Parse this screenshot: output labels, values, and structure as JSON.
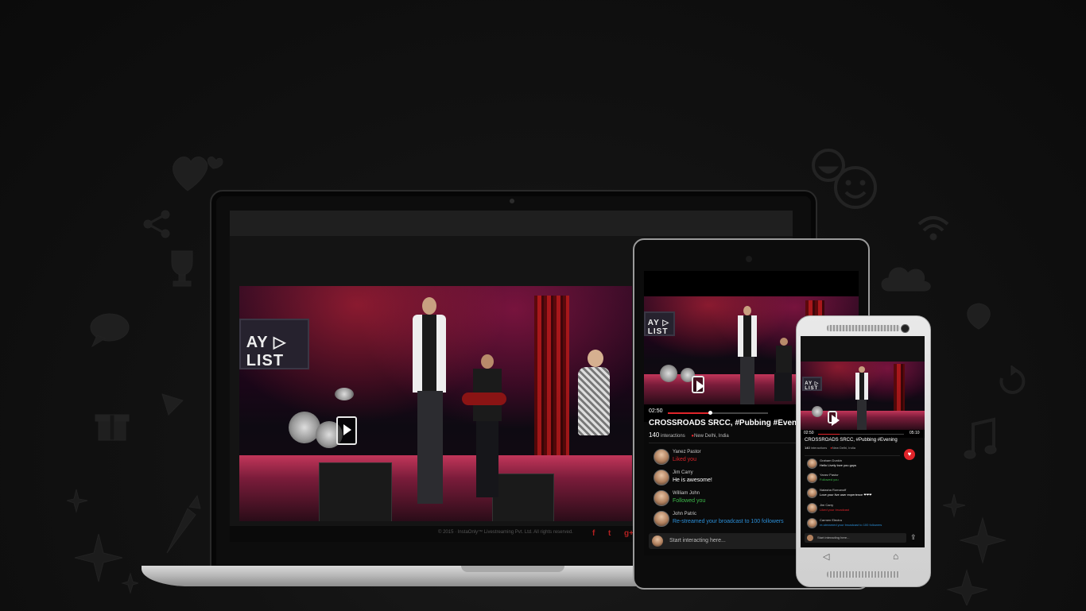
{
  "laptop": {
    "footer": {
      "copyright": "© 2015 · InstaOnly™ Livestreaming Pvt. Ltd. All rights reserved.",
      "social": [
        "f",
        "t",
        "g+"
      ]
    },
    "banner_text": "AY ▷ LIST"
  },
  "tablet": {
    "time": "02:50",
    "title": "CROSSROADS SRCC, #Pubbing #Evening",
    "interactions_count": "140",
    "interactions_label": "interactions",
    "location": "New Delhi, India",
    "progress": 0.42,
    "comments": [
      {
        "name": "Yanez Pastor",
        "text": "Liked you",
        "kind": "red"
      },
      {
        "name": "Jim Carry",
        "text": "He is awesome!",
        "kind": "white"
      },
      {
        "name": "William John",
        "text": "Followed you",
        "kind": "green"
      },
      {
        "name": "John Patric",
        "text": "Re-streamed your broadcast to 100 followers",
        "kind": "blue"
      }
    ],
    "input_placeholder": "Start interacting here..."
  },
  "phone": {
    "time_start": "02:50",
    "time_end": "05:10",
    "title": "CROSSROADS SRCC, #Pubbing #Evening",
    "interactions_count": "140",
    "interactions_label": "interactions",
    "location": "New Delhi, India",
    "progress": 0.25,
    "comments": [
      {
        "name": "Graham Dunkin",
        "text": "Hello Lively love you guys",
        "kind": "white"
      },
      {
        "name": "Yanez Pastor",
        "text": "Followed you",
        "kind": "green"
      },
      {
        "name": "Natasha Romanoff",
        "text": "Love your live user experience ❤❤❤",
        "kind": "white"
      },
      {
        "name": "Jim Carry",
        "text": "Liked your broadcast",
        "kind": "red"
      },
      {
        "name": "Carmen Electra",
        "text": "re-streamed your broadcast to 100 followers",
        "kind": "blue"
      }
    ],
    "input_placeholder": "Start interacting here...",
    "nav_back": "◁",
    "nav_home": "⌂"
  },
  "colors": {
    "accent": "#e0242a",
    "green": "#3db94a",
    "blue": "#2b8fd8"
  },
  "icons": [
    "heart-icon",
    "share-icon",
    "trophy-icon",
    "chat-bubble-icon",
    "gift-icon",
    "play-icon",
    "star-icon",
    "smiley-icon",
    "wifi-icon",
    "cloud-icon",
    "music-note-icon",
    "refresh-icon"
  ]
}
